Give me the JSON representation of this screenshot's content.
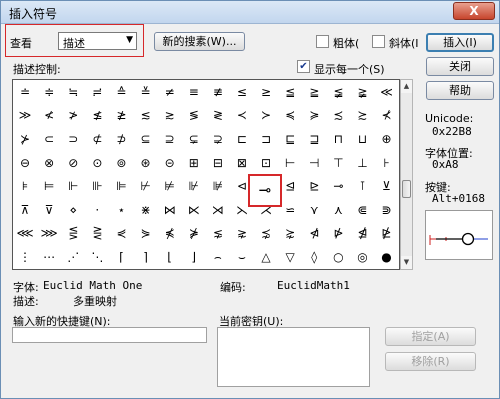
{
  "window": {
    "title": "插入符号",
    "close_label": "X"
  },
  "view": {
    "label": "查看",
    "selected": "描述"
  },
  "buttons": {
    "new_search": "新的搜素(W)...",
    "insert": "插入(I)",
    "close": "关闭",
    "help": "帮助",
    "assign": "指定(A)",
    "remove": "移除(R)"
  },
  "checkboxes": {
    "bold": {
      "label": "粗体(",
      "checked": false
    },
    "italic": {
      "label": "斜体(I",
      "checked": false
    },
    "show_each": {
      "label": "显示每一个(S)",
      "checked": true
    }
  },
  "controls_label": "描述控制:",
  "right_panel": {
    "unicode_label": "Unicode:",
    "unicode_value": "0x22B8",
    "font_pos_label": "字体位置:",
    "font_pos_value": "0xA8",
    "keystroke_label": "按键:",
    "keystroke_value": "Alt+0168"
  },
  "info": {
    "font_label": "字体:",
    "font_value": "Euclid Math One",
    "encoding_label": "编码:",
    "encoding_value": "EuclidMath1",
    "desc_label": "描述:",
    "desc_value": "多重映射"
  },
  "shortcut": {
    "new_label": "输入新的快捷键(N):",
    "current_label": "当前密钥(U):"
  },
  "symbols": [
    [
      "≐",
      "≑",
      "≒",
      "≓",
      "≙",
      "≚",
      "≠",
      "≡",
      "≢",
      "≤",
      "≥",
      "≦",
      "≧",
      "≨",
      "≩",
      "≪"
    ],
    [
      "≫",
      "≮",
      "≯",
      "≰",
      "≱",
      "≲",
      "≳",
      "≶",
      "≷",
      "≺",
      "≻",
      "≼",
      "≽",
      "≾",
      "≿",
      "⊀"
    ],
    [
      "⊁",
      "⊂",
      "⊃",
      "⊄",
      "⊅",
      "⊆",
      "⊇",
      "⊊",
      "⊋",
      "⊏",
      "⊐",
      "⊑",
      "⊒",
      "⊓",
      "⊔",
      "⊕"
    ],
    [
      "⊖",
      "⊗",
      "⊘",
      "⊙",
      "⊚",
      "⊛",
      "⊝",
      "⊞",
      "⊟",
      "⊠",
      "⊡",
      "⊢",
      "⊣",
      "⊤",
      "⊥",
      "⊦"
    ],
    [
      "⊧",
      "⊨",
      "⊩",
      "⊪",
      "⊫",
      "⊬",
      "⊭",
      "⊮",
      "⊯",
      "⊲",
      "⊳",
      "⊴",
      "⊵",
      "⊸",
      "⊺",
      "⊻"
    ],
    [
      "⊼",
      "⊽",
      "⋄",
      "⋅",
      "⋆",
      "⋇",
      "⋈",
      "⋉",
      "⋊",
      "⋋",
      "⋌",
      "⋍",
      "⋎",
      "⋏",
      "⋐",
      "⋑"
    ],
    [
      "⋘",
      "⋙",
      "⋚",
      "⋛",
      "⋞",
      "⋟",
      "⋠",
      "⋡",
      "⋦",
      "⋧",
      "⋨",
      "⋩",
      "⋪",
      "⋫",
      "⋬",
      "⋭"
    ],
    [
      "⋮",
      "⋯",
      "⋰",
      "⋱",
      "⌈",
      "⌉",
      "⌊",
      "⌋",
      "⌢",
      "⌣",
      "△",
      "▽",
      "◊",
      "○",
      "◎",
      "●"
    ]
  ],
  "selected_symbol": "⊸"
}
